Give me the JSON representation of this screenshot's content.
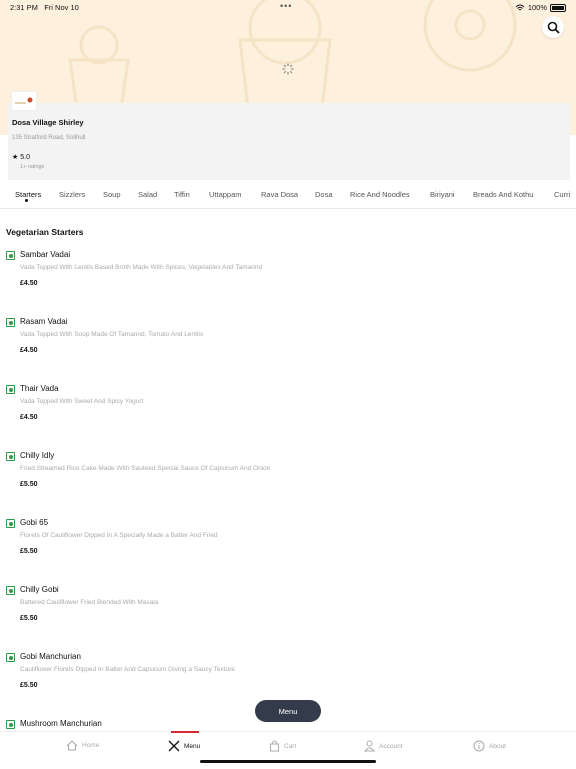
{
  "status_bar": {
    "time": "2:31 PM",
    "date": "Fri Nov 10",
    "battery": "100%"
  },
  "restaurant": {
    "logo_icon": "restaurant-logo",
    "name": "Dosa Village Shirley",
    "address": "135 Stratford Road, Solihull",
    "rating": "5.0",
    "rating_count": "1+ ratings"
  },
  "tabs": [
    {
      "label": "Starters",
      "active": true
    },
    {
      "label": "Sizzlers"
    },
    {
      "label": "Soup"
    },
    {
      "label": "Salad"
    },
    {
      "label": "Tiffin"
    },
    {
      "label": "Uttappam"
    },
    {
      "label": "Rava Dosa"
    },
    {
      "label": "Dosa"
    },
    {
      "label": "Rice And Noodles"
    },
    {
      "label": "Biriyani"
    },
    {
      "label": "Breads And Kothu"
    },
    {
      "label": "Curri"
    }
  ],
  "section": {
    "title": "Vegetarian Starters"
  },
  "items": [
    {
      "name": "Sambar Vadai",
      "desc": "Vada Topped With Lentils Based Broth Made With Spices, Vegetables And Tamarind",
      "price": "£4.50"
    },
    {
      "name": "Rasam Vadai",
      "desc": "Vada Topped With Soup Made Of Tamarind, Tomato And Lentils",
      "price": "£4.50"
    },
    {
      "name": "Thair Vada",
      "desc": "Vada Topped With Sweet And Spicy Yogurt",
      "price": "£4.50"
    },
    {
      "name": "Chilly Idly",
      "desc": "Fried Streamed Rice Cake Made With Sauteed Special Sauce Of Capsicum And Onion",
      "price": "£5.50"
    },
    {
      "name": "Gobi 65",
      "desc": "Florets Of Cauliflower Dipped In A Specially Made a Batter And Fried",
      "price": "£5.50"
    },
    {
      "name": "Chilly Gobi",
      "desc": "Battered Cauliflower Fried Blended With Masala",
      "price": "£5.50"
    },
    {
      "name": "Gobi Manchurian",
      "desc": "Cauliflower Florets Dipped In Batter And Capsicum Giving a Saucy Texture",
      "price": "£5.50"
    },
    {
      "name": "Mushroom Manchurian",
      "desc": "",
      "price": ""
    }
  ],
  "menu_button": {
    "label": "Menu"
  },
  "bottom_nav": [
    {
      "label": "Home",
      "icon": "home-icon"
    },
    {
      "label": "Menu",
      "icon": "cutlery-icon",
      "active": true
    },
    {
      "label": "Cart",
      "icon": "bag-icon"
    },
    {
      "label": "Account",
      "icon": "person-icon"
    },
    {
      "label": "About",
      "icon": "info-icon"
    }
  ],
  "colors": {
    "accent": "#d22a36",
    "veg": "#2e9b48",
    "pill": "#343b4a",
    "hero_bg": "#fdf0dc"
  }
}
